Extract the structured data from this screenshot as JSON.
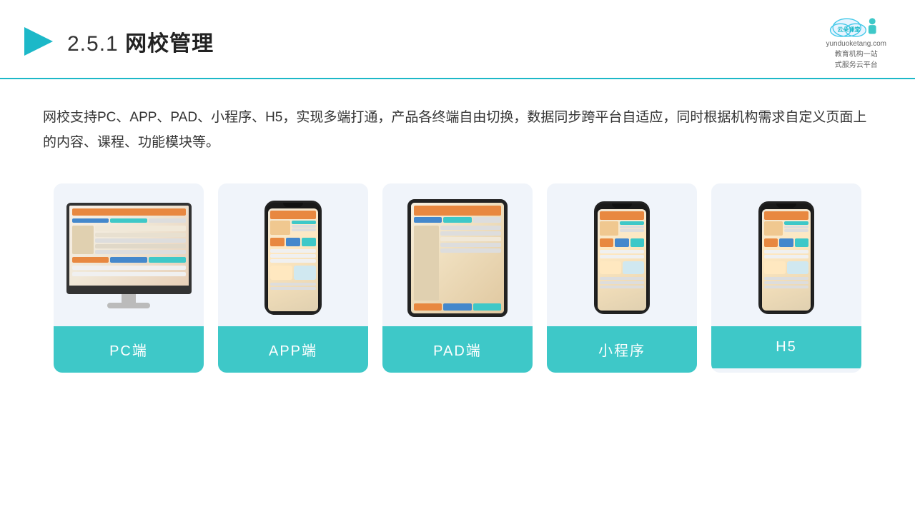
{
  "header": {
    "title_number": "2.5.1",
    "title_text": "网校管理",
    "logo_name": "云朵课堂",
    "logo_sub": "yunduoketang.com",
    "logo_slogan": "教育机构一站\n式服务云平台"
  },
  "description": {
    "text": "网校支持PC、APP、PAD、小程序、H5，实现多端打通，产品各终端自由切换，数据同步跨平台自适应，同时根据机构需求自定义页面上的内容、课程、功能模块等。"
  },
  "cards": [
    {
      "id": "pc",
      "label": "PC端"
    },
    {
      "id": "app",
      "label": "APP端"
    },
    {
      "id": "pad",
      "label": "PAD端"
    },
    {
      "id": "miniapp",
      "label": "小程序"
    },
    {
      "id": "h5",
      "label": "H5"
    }
  ]
}
